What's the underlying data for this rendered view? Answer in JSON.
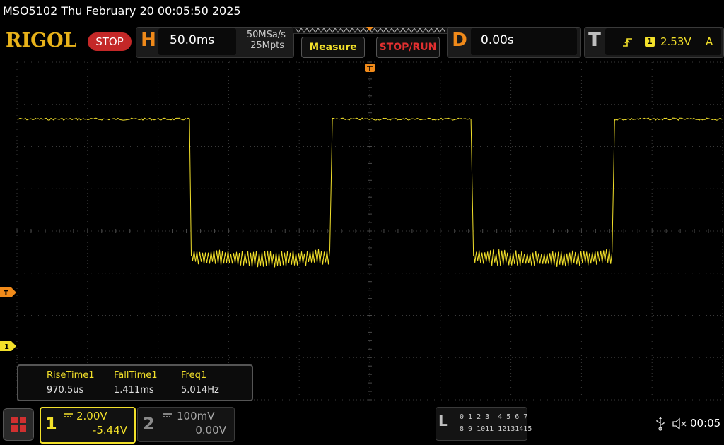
{
  "title": "MSO5102  Thu February 20 00:05:50 2025",
  "logo": "RIGOL",
  "run_state": "STOP",
  "horizontal": {
    "letter": "H",
    "timebase": "50.0ms",
    "sample_rate": "50MSa/s",
    "memory_depth": "25Mpts"
  },
  "buttons": {
    "measure": "Measure",
    "stop_run": "STOP/RUN"
  },
  "delay": {
    "letter": "D",
    "value": "0.00s"
  },
  "trigger": {
    "letter": "T",
    "source": "1",
    "level": "2.53V",
    "mode": "A",
    "marker": "T",
    "edge_icon": "rising-edge-icon"
  },
  "measurements": [
    {
      "label": "RiseTime1",
      "value": "970.5us"
    },
    {
      "label": "FallTime1",
      "value": "1.411ms"
    },
    {
      "label": "Freq1",
      "value": "5.014Hz"
    }
  ],
  "channels": [
    {
      "number": "1",
      "scale": "2.00V",
      "offset": "-5.44V",
      "coupling_icon": "dc-coupling-icon",
      "active": true,
      "color": "#f2e02a"
    },
    {
      "number": "2",
      "scale": "100mV",
      "offset": "0.00V",
      "coupling_icon": "dc-coupling-icon",
      "active": false,
      "color": "#8a8a8a"
    }
  ],
  "ch1_marker": "1",
  "logic": {
    "letter": "L",
    "row1": "0 1 2 3  4 5 6 7",
    "row2": "8 9 1011 12131415"
  },
  "status": {
    "time": "00:05"
  },
  "colors": {
    "ch1": "#f2e02a",
    "trigger": "#f08a1a",
    "stop": "#c42828",
    "logo": "#e8b21a"
  },
  "waveform": {
    "high_level_div": 2.65,
    "low_level_div": -0.6,
    "period_div": 4.0,
    "first_fall_div": 2.45
  }
}
